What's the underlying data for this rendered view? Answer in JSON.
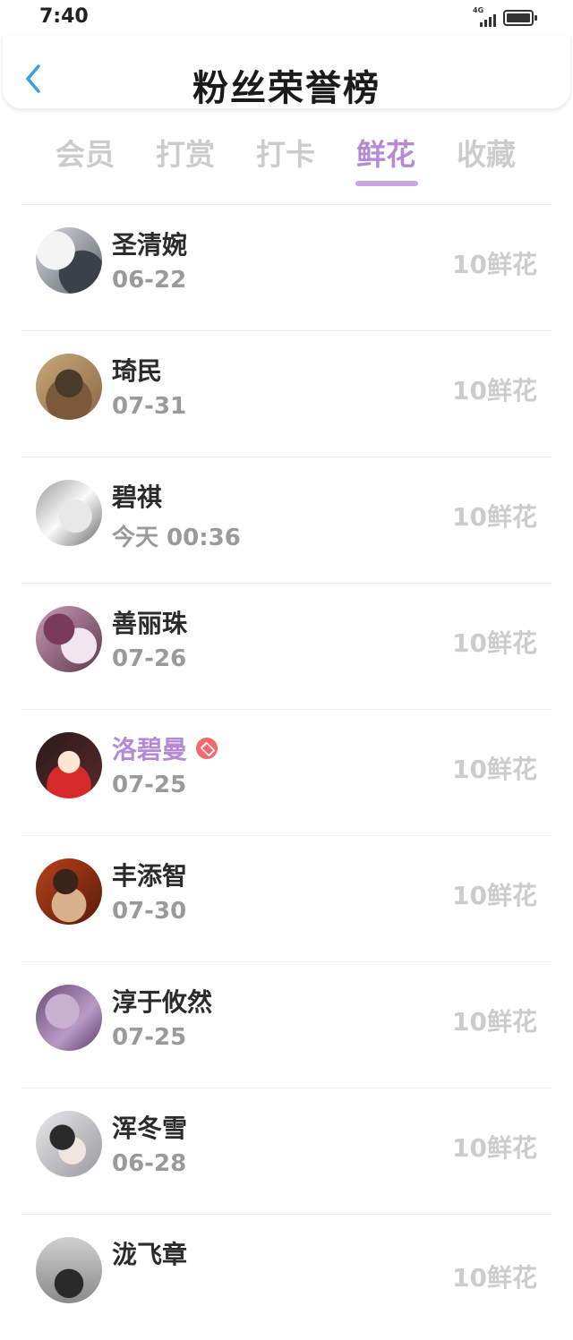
{
  "status_bar": {
    "time": "7:40",
    "network": "4G",
    "icons": [
      "signal-icon",
      "battery-icon"
    ]
  },
  "header": {
    "title": "粉丝荣誉榜",
    "back_icon": "chevron-left-icon",
    "accent": "#3a9ee0"
  },
  "tabs": [
    {
      "label": "会员",
      "active": false
    },
    {
      "label": "打赏",
      "active": false
    },
    {
      "label": "打卡",
      "active": false
    },
    {
      "label": "鲜花",
      "active": true
    },
    {
      "label": "收藏",
      "active": false
    }
  ],
  "colors": {
    "active_tab": "#b48ad6",
    "inactive_tab": "#cccccc",
    "value_text": "#cccccc",
    "vip_name": "#b48ad6",
    "vip_badge": "#ef6b6f"
  },
  "fans": [
    {
      "name": "圣清婉",
      "date": "06-22",
      "value": "10鲜花",
      "vip": false
    },
    {
      "name": "琦民",
      "date": "07-31",
      "value": "10鲜花",
      "vip": false
    },
    {
      "name": "碧祺",
      "date": "今天 00:36",
      "value": "10鲜花",
      "vip": false
    },
    {
      "name": "善丽珠",
      "date": "07-26",
      "value": "10鲜花",
      "vip": false
    },
    {
      "name": "洛碧曼",
      "date": "07-25",
      "value": "10鲜花",
      "vip": true
    },
    {
      "name": "丰添智",
      "date": "07-30",
      "value": "10鲜花",
      "vip": false
    },
    {
      "name": "淳于攸然",
      "date": "07-25",
      "value": "10鲜花",
      "vip": false
    },
    {
      "name": "浑冬雪",
      "date": "06-28",
      "value": "10鲜花",
      "vip": false
    },
    {
      "name": "泷飞章",
      "date": "",
      "value": "10鲜花",
      "vip": false
    }
  ]
}
